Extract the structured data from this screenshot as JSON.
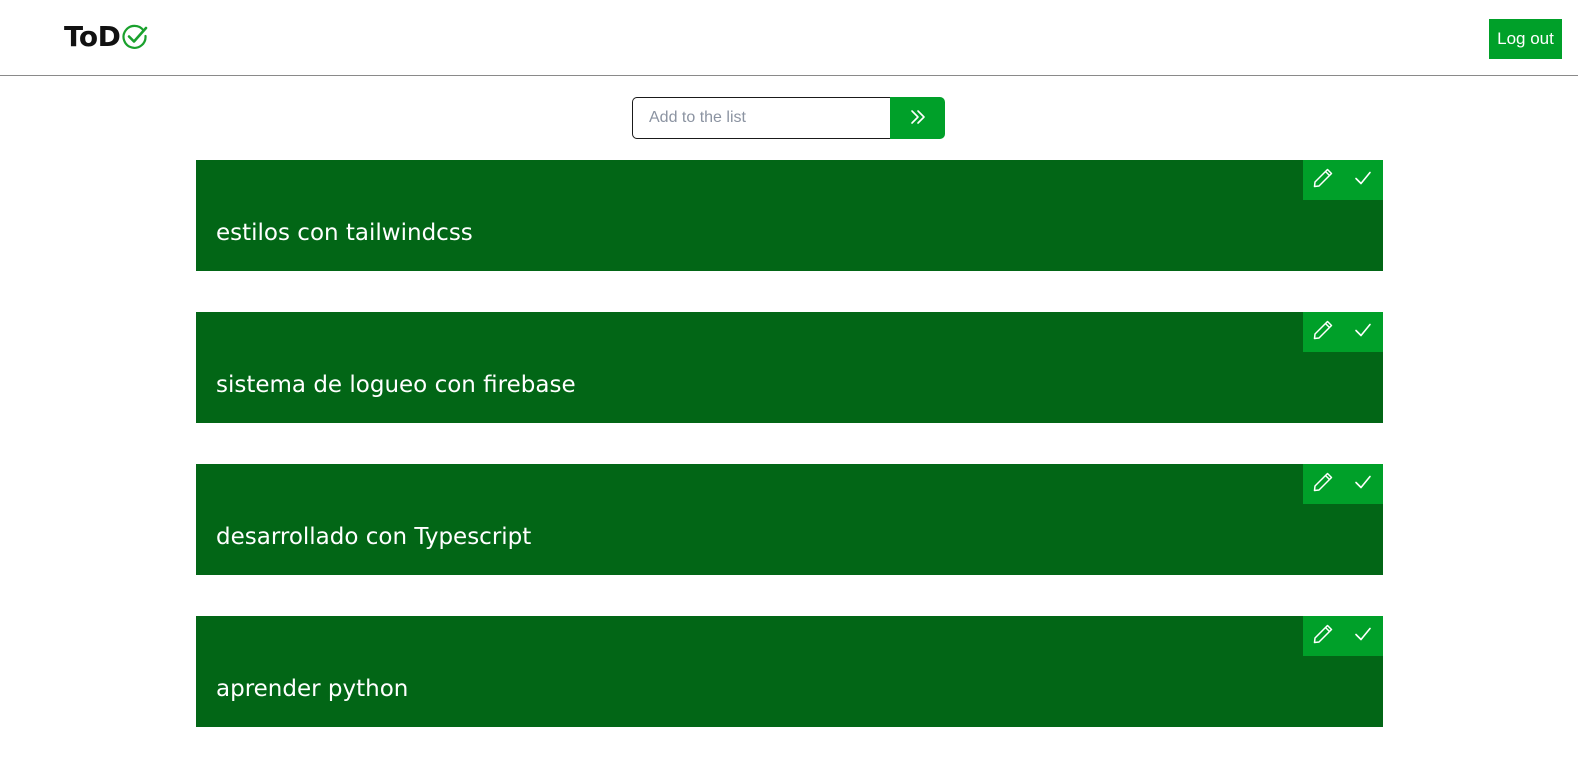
{
  "header": {
    "logo_text": "ToD",
    "logo_icon": "check-circle-icon",
    "logout_label": "Log out"
  },
  "add_form": {
    "input_value": "",
    "placeholder": "Add to the list",
    "submit_icon": "double-chevron-right-icon"
  },
  "todos": [
    {
      "text": "estilos con tailwindcss",
      "edit_icon": "pencil-icon",
      "done_icon": "check-icon"
    },
    {
      "text": "sistema de logueo con firebase",
      "edit_icon": "pencil-icon",
      "done_icon": "check-icon"
    },
    {
      "text": "desarrollado con Typescript",
      "edit_icon": "pencil-icon",
      "done_icon": "check-icon"
    },
    {
      "text": "aprender python",
      "edit_icon": "pencil-icon",
      "done_icon": "check-icon"
    }
  ],
  "colors": {
    "accent": "#00a029",
    "item_background": "#026616",
    "logo_check": "#1aa12d"
  }
}
